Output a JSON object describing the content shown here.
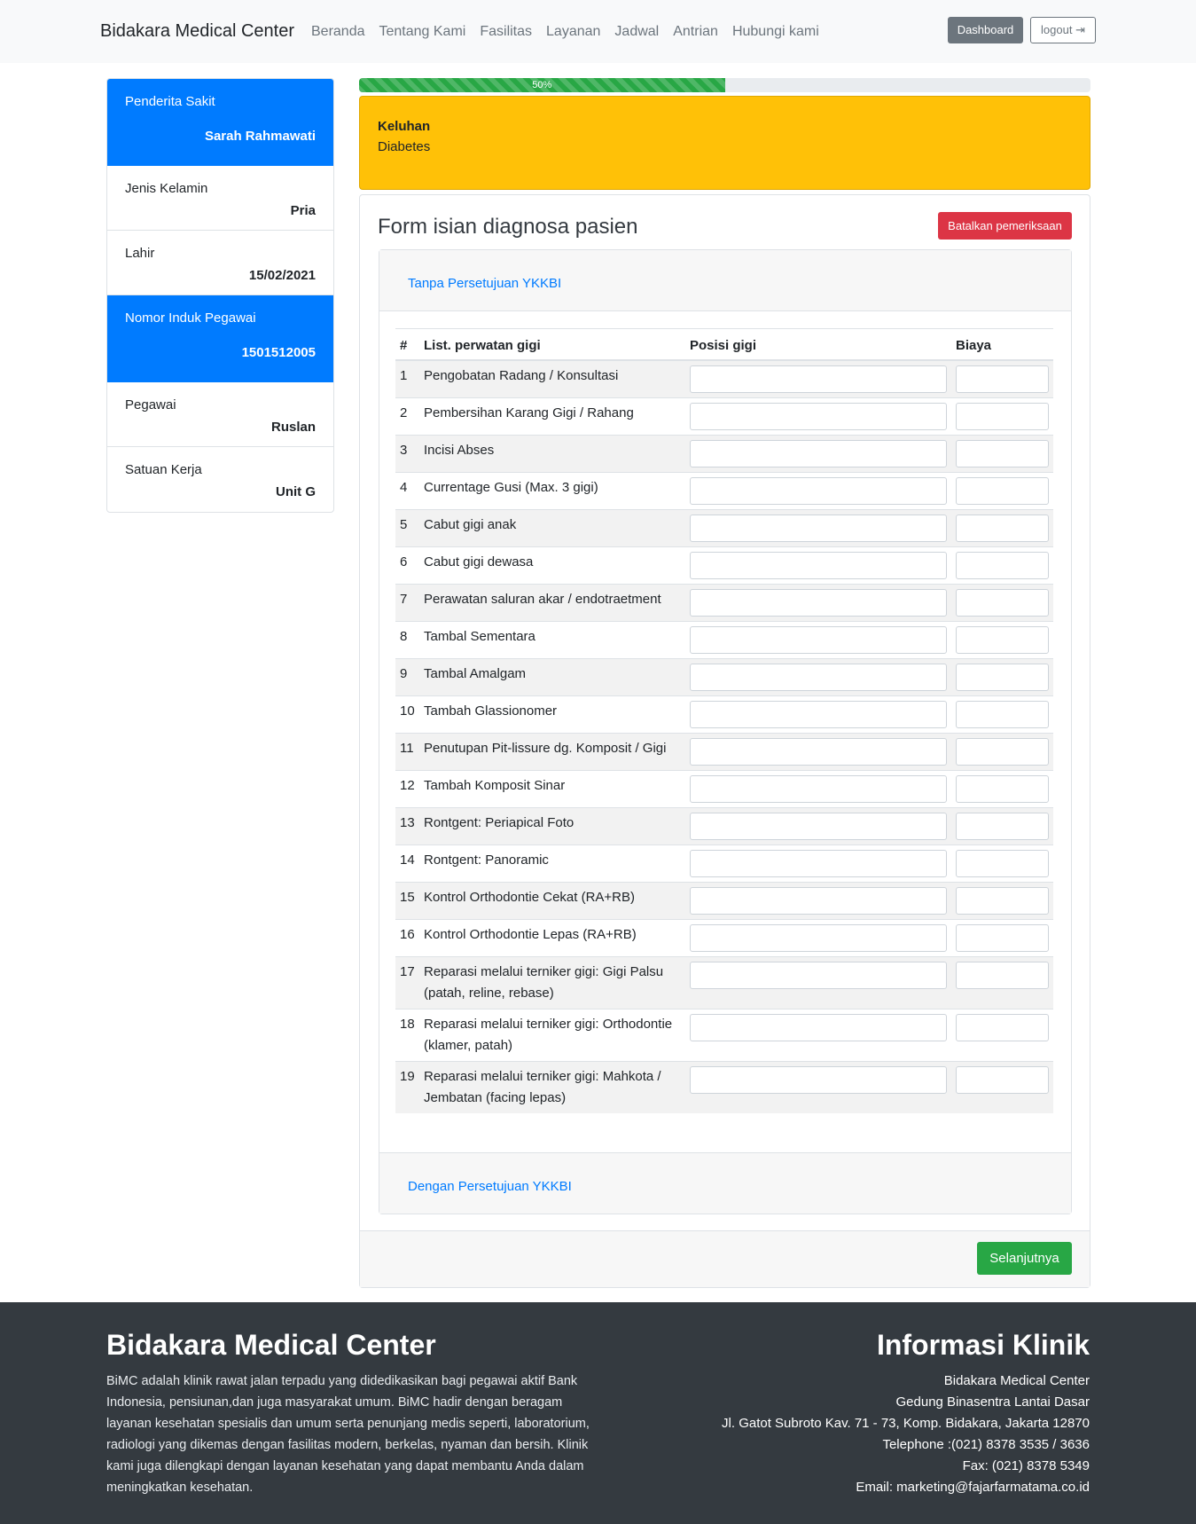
{
  "navbar": {
    "brand": "Bidakara Medical Center",
    "links": [
      "Beranda",
      "Tentang Kami",
      "Fasilitas",
      "Layanan",
      "Jadwal",
      "Antrian",
      "Hubungi kami"
    ],
    "dashboard_label": "Dashboard",
    "logout_label": "logout ⇥"
  },
  "sidebar": {
    "items": [
      {
        "label": "Penderita Sakit",
        "value": "Sarah Rahmawati"
      },
      {
        "label": "Jenis Kelamin",
        "value": "Pria"
      },
      {
        "label": "Lahir",
        "value": "15/02/2021"
      },
      {
        "label": "Nomor Induk Pegawai",
        "value": "1501512005"
      },
      {
        "label": "Pegawai",
        "value": "Ruslan"
      },
      {
        "label": "Satuan Kerja",
        "value": "Unit G"
      }
    ]
  },
  "progress": {
    "value": 0.5,
    "label": "50%"
  },
  "complaint": {
    "title": "Keluhan",
    "text": "Diabetes"
  },
  "form": {
    "title": "Form isian diagnosa pasien",
    "cancel_label": "Batalkan pemeriksaan",
    "section_top": "Tanpa Persetujuan YKKBI",
    "section_bottom": "Dengan Persetujuan YKKBI",
    "next_label": "Selanjutnya",
    "headers": {
      "num": "#",
      "name": "List. perwatan gigi",
      "pos": "Posisi gigi",
      "cost": "Biaya"
    },
    "rows": [
      {
        "num": "1",
        "name": "Pengobatan Radang / Konsultasi"
      },
      {
        "num": "2",
        "name": "Pembersihan Karang Gigi / Rahang"
      },
      {
        "num": "3",
        "name": "Incisi Abses"
      },
      {
        "num": "4",
        "name": "Currentage Gusi (Max. 3 gigi)"
      },
      {
        "num": "5",
        "name": "Cabut gigi anak"
      },
      {
        "num": "6",
        "name": "Cabut gigi dewasa"
      },
      {
        "num": "7",
        "name": "Perawatan saluran akar / endotraetment"
      },
      {
        "num": "8",
        "name": "Tambal Sementara"
      },
      {
        "num": "9",
        "name": "Tambal Amalgam"
      },
      {
        "num": "10",
        "name": "Tambah Glassionomer"
      },
      {
        "num": "11",
        "name": "Penutupan Pit-lissure dg. Komposit / Gigi"
      },
      {
        "num": "12",
        "name": "Tambah Komposit Sinar"
      },
      {
        "num": "13",
        "name": "Rontgent: Periapical Foto"
      },
      {
        "num": "14",
        "name": "Rontgent: Panoramic"
      },
      {
        "num": "15",
        "name": "Kontrol Orthodontie Cekat (RA+RB)"
      },
      {
        "num": "16",
        "name": "Kontrol Orthodontie Lepas (RA+RB)"
      },
      {
        "num": "17",
        "name": "Reparasi melalui terniker gigi: Gigi Palsu (patah, reline, rebase)"
      },
      {
        "num": "18",
        "name": "Reparasi melalui terniker gigi: Orthodontie (klamer, patah)"
      },
      {
        "num": "19",
        "name": "Reparasi melalui terniker gigi: Mahkota / Jembatan (facing lepas)"
      }
    ]
  },
  "footer": {
    "left_title": "Bidakara Medical Center",
    "left_text": "BiMC adalah klinik rawat jalan terpadu yang didedikasikan bagi pegawai aktif Bank Indonesia, pensiunan,dan juga masyarakat umum. BiMC hadir dengan beragam layanan kesehatan spesialis dan umum serta penunjang medis seperti, laboratorium, radiologi yang dikemas dengan fasilitas modern, berkelas, nyaman dan bersih. Klinik kami juga dilengkapi dengan layanan kesehatan yang dapat membantu Anda dalam meningkatkan kesehatan.",
    "right_title": "Informasi Klinik",
    "right_lines": [
      "Bidakara Medical Center",
      "Gedung Binasentra Lantai Dasar",
      "Jl. Gatot Subroto Kav. 71 - 73, Komp. Bidakara, Jakarta 12870",
      "Telephone :(021) 8378 3535 / 3636",
      "Fax: (021) 8378 5349",
      "Email: marketing@fajarfarmatama.co.id"
    ]
  }
}
